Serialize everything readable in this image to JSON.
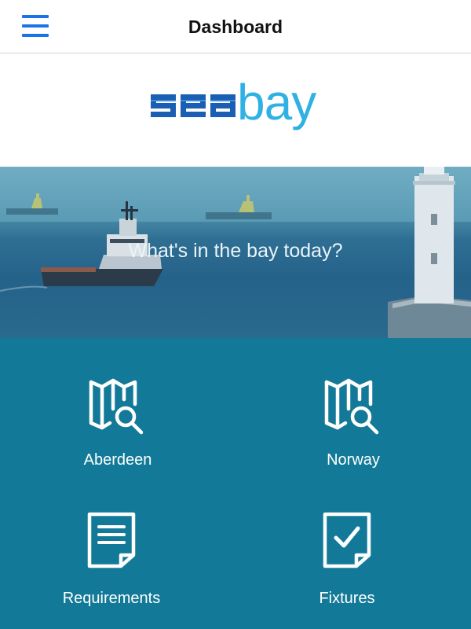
{
  "header": {
    "title": "Dashboard",
    "menu_icon": "hamburger-menu-icon",
    "accent_color": "#1a73e8"
  },
  "logo": {
    "brand_text": "seabay",
    "colors": {
      "sea": "#1a5fb4",
      "bay": "#2fb1e3"
    }
  },
  "hero": {
    "title": "What's in the bay today?"
  },
  "dashboard": {
    "background_color": "#127a98",
    "tiles": [
      {
        "label": "Aberdeen",
        "icon": "map-search-icon"
      },
      {
        "label": "Norway",
        "icon": "map-search-icon"
      },
      {
        "label": "Requirements",
        "icon": "document-lines-icon"
      },
      {
        "label": "Fixtures",
        "icon": "document-check-icon"
      }
    ]
  }
}
